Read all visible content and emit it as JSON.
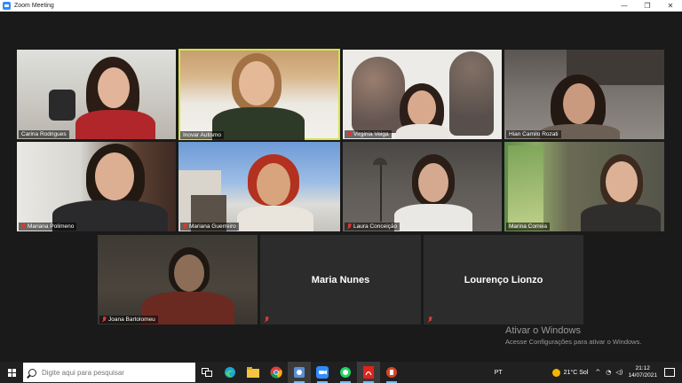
{
  "window": {
    "title": "Zoom Meeting",
    "controls": [
      "—",
      "❐",
      "✕"
    ]
  },
  "participants": [
    {
      "name": "Carina Rodrigues",
      "muted": false,
      "active": false
    },
    {
      "name": "Inovar Autismo",
      "muted": false,
      "active": true
    },
    {
      "name": "Virginia Veiga",
      "muted": true,
      "active": false
    },
    {
      "name": "Hian Camilo Rozati",
      "muted": false,
      "active": false
    },
    {
      "name": "Mariana Polimeno",
      "muted": true,
      "active": false
    },
    {
      "name": "Mariana Guerreiro",
      "muted": true,
      "active": false
    },
    {
      "name": "Laura Conceição",
      "muted": true,
      "active": false
    },
    {
      "name": "Marina Correia",
      "muted": false,
      "active": false
    },
    {
      "name": "Joana Bartolomeu",
      "muted": true,
      "active": false
    },
    {
      "name": "Maria Nunes",
      "muted": true,
      "active": false,
      "video_off": true
    },
    {
      "name": "Lourenço Lionzo",
      "muted": true,
      "active": false,
      "video_off": true
    }
  ],
  "watermark": {
    "line1": "Ativar o Windows",
    "line2": "Acesse Configurações para ativar o Windows."
  },
  "taskbar": {
    "search_placeholder": "Digite aqui para pesquisar",
    "language": "PT",
    "weather": "21°C  Sol",
    "time": "21:12",
    "date": "14/07/2021"
  }
}
